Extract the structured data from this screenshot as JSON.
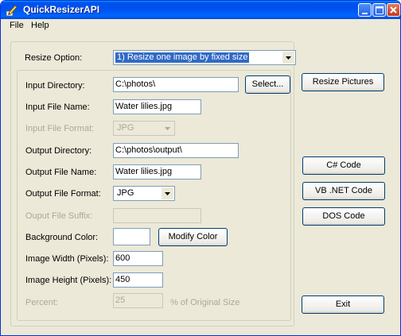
{
  "window": {
    "title": "QuickResizerAPI"
  },
  "menu": {
    "file": "File",
    "help": "Help"
  },
  "resize_option": {
    "label": "Resize Option:",
    "value": "1) Resize one image by fixed size"
  },
  "form": {
    "input_directory": {
      "label": "Input Directory:",
      "value": "C:\\photos\\"
    },
    "select_button": "Select...",
    "input_file_name": {
      "label": "Input File Name:",
      "value": "Water lilies.jpg"
    },
    "input_file_format": {
      "label": "Input File Format:",
      "value": "JPG"
    },
    "output_directory": {
      "label": "Output Directory:",
      "value": "C:\\photos\\output\\"
    },
    "output_file_name": {
      "label": "Output File Name:",
      "value": "Water lilies.jpg"
    },
    "output_file_format": {
      "label": "Output File Format:",
      "value": "JPG"
    },
    "output_file_suffix": {
      "label": "Ouput File Suffix:",
      "value": ""
    },
    "background_color": {
      "label": "Background Color:",
      "value": ""
    },
    "modify_color_button": "Modify Color",
    "image_width": {
      "label": "Image Width (Pixels):",
      "value": "600"
    },
    "image_height": {
      "label": "Image Height (Pixels):",
      "value": "450"
    },
    "percent": {
      "label": "Percent:",
      "value": "25",
      "suffix": "% of Original Size"
    }
  },
  "buttons": {
    "resize_pictures": "Resize Pictures",
    "csharp_code": "C# Code",
    "vbnet_code": "VB .NET Code",
    "dos_code": "DOS Code",
    "exit": "Exit"
  },
  "colors": {
    "title_bar": "#0053ee",
    "window_bg": "#ece9d8",
    "selection": "#316ac5",
    "disabled_text": "#aca899"
  }
}
